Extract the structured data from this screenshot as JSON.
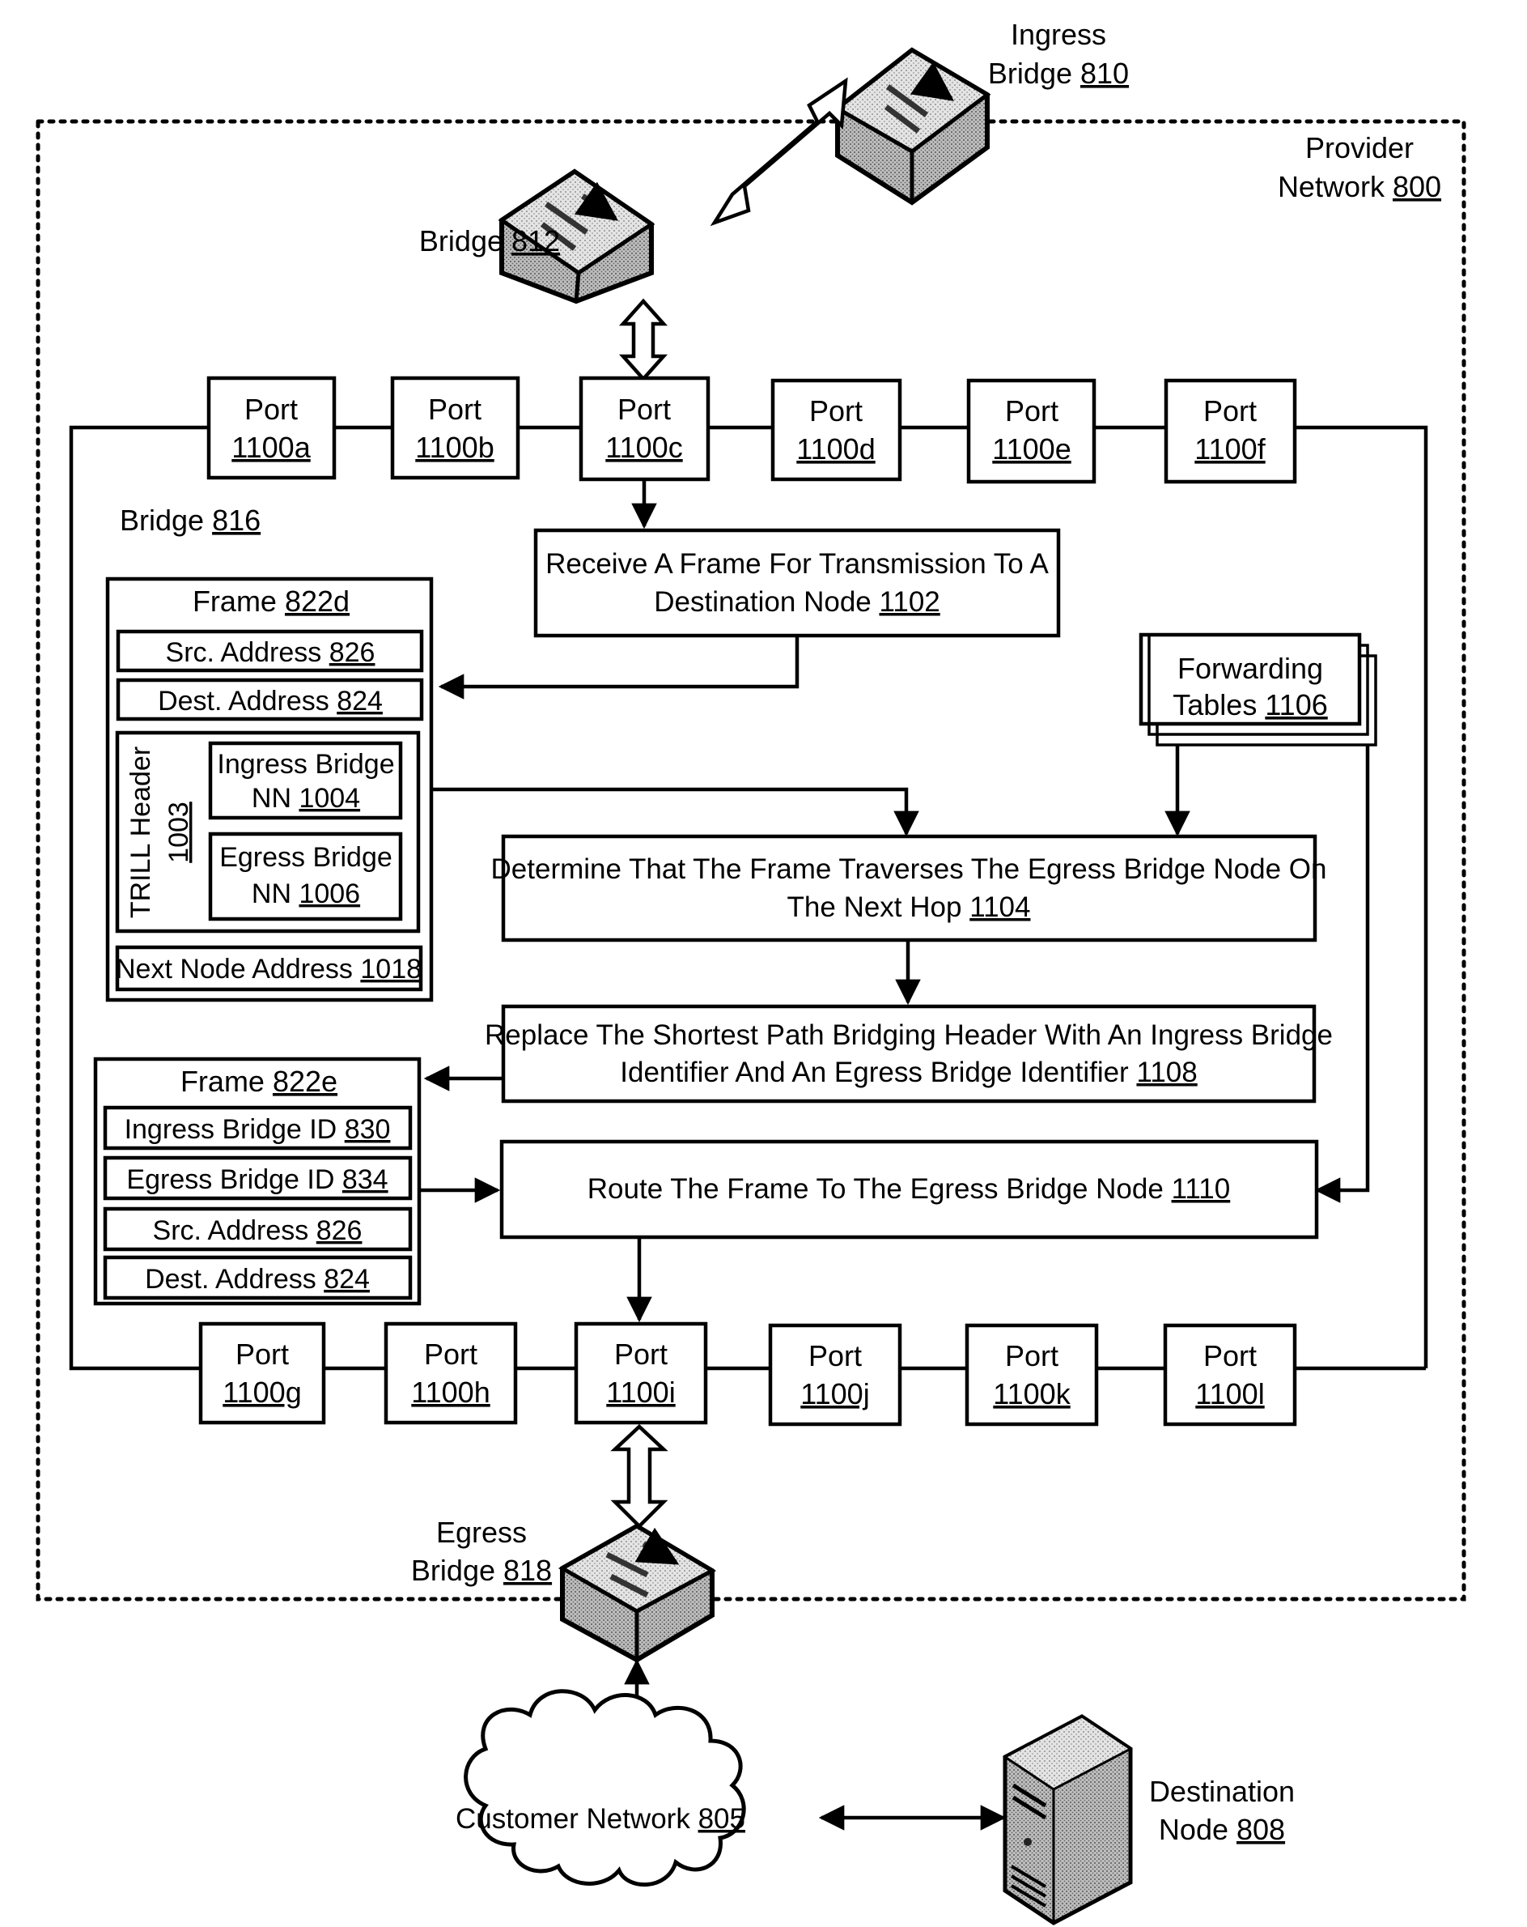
{
  "network": {
    "provider": {
      "line1": "Provider",
      "line2": "Network",
      "ref": "800"
    },
    "bridge_816": {
      "text": "Bridge",
      "ref": "816"
    }
  },
  "devices": {
    "ingress_bridge": {
      "line1": "Ingress",
      "line2": "Bridge",
      "ref": "810"
    },
    "bridge_812": {
      "text": "Bridge",
      "ref": "812"
    },
    "egress_bridge": {
      "line1": "Egress",
      "line2": "Bridge",
      "ref": "818"
    },
    "customer_network": {
      "text": "Customer Network",
      "ref": "805"
    },
    "destination_node": {
      "line1": "Destination",
      "line2": "Node",
      "ref": "808"
    }
  },
  "ports_top": [
    {
      "label": "Port",
      "ref": "1100a"
    },
    {
      "label": "Port",
      "ref": "1100b"
    },
    {
      "label": "Port",
      "ref": "1100c"
    },
    {
      "label": "Port",
      "ref": "1100d"
    },
    {
      "label": "Port",
      "ref": "1100e"
    },
    {
      "label": "Port",
      "ref": "1100f"
    }
  ],
  "ports_bottom": [
    {
      "label": "Port",
      "ref": "1100g"
    },
    {
      "label": "Port",
      "ref": "1100h"
    },
    {
      "label": "Port",
      "ref": "1100i"
    },
    {
      "label": "Port",
      "ref": "1100j"
    },
    {
      "label": "Port",
      "ref": "1100k"
    },
    {
      "label": "Port",
      "ref": "1100l"
    }
  ],
  "steps": {
    "s1102": {
      "line1": "Receive A Frame For Transmission To A",
      "line2": "Destination Node",
      "ref": "1102"
    },
    "s1104": {
      "line1": "Determine That The Frame Traverses The Egress Bridge Node On",
      "line2": "The Next Hop",
      "ref": "1104"
    },
    "s1108": {
      "line1": "Replace The Shortest Path Bridging Header With An Ingress Bridge",
      "line2": "Identifier And An Egress Bridge Identifier",
      "ref": "1108"
    },
    "s1110": {
      "line1": "Route The Frame To The Egress Bridge Node",
      "ref": "1110"
    }
  },
  "forwarding_tables": {
    "line1": "Forwarding",
    "line2": "Tables",
    "ref": "1106"
  },
  "frame_822d": {
    "title": "Frame",
    "ref": "822d",
    "src": {
      "text": "Src. Address",
      "ref": "826"
    },
    "dest": {
      "text": "Dest. Address",
      "ref": "824"
    },
    "trill": {
      "text": "TRILL Header",
      "ref": "1003"
    },
    "ingress_nn": {
      "line1": "Ingress Bridge",
      "line2": "NN",
      "ref": "1004"
    },
    "egress_nn": {
      "line1": "Egress Bridge",
      "line2": "NN",
      "ref": "1006"
    },
    "next_node": {
      "text": "Next Node Address",
      "ref": "1018"
    }
  },
  "frame_822e": {
    "title": "Frame",
    "ref": "822e",
    "ingress_id": {
      "text": "Ingress Bridge ID",
      "ref": "830"
    },
    "egress_id": {
      "text": "Egress Bridge ID",
      "ref": "834"
    },
    "src": {
      "text": "Src. Address",
      "ref": "826"
    },
    "dest": {
      "text": "Dest. Address",
      "ref": "824"
    }
  }
}
